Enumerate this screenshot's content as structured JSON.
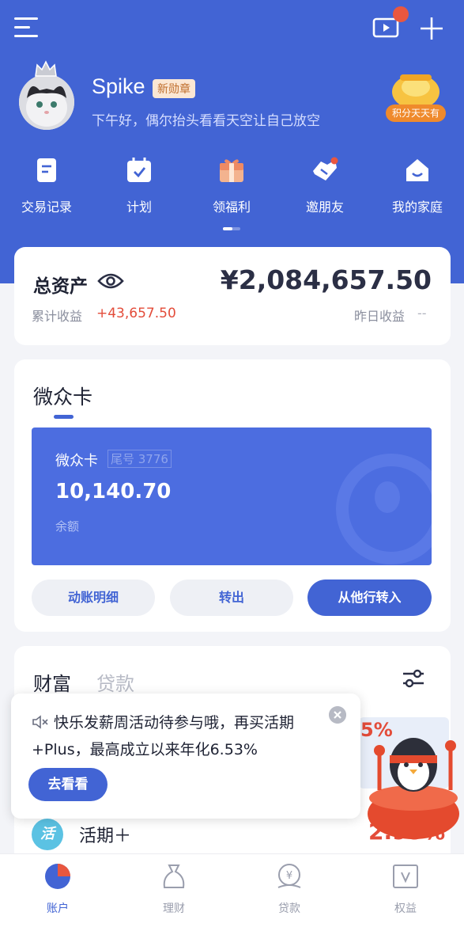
{
  "header": {
    "menu_icon": "menu-icon",
    "video_icon": "video-icon",
    "plus_icon": "plus-icon"
  },
  "profile": {
    "username": "Spike",
    "badge": "新勋章",
    "greeting": "下午好，偶尔抬头看看天空让自己放空",
    "promo_label": "积分天天有"
  },
  "quick_actions": [
    {
      "label": "交易记录",
      "icon": "document-icon"
    },
    {
      "label": "计划",
      "icon": "calendar-icon"
    },
    {
      "label": "领福利",
      "icon": "gift-icon"
    },
    {
      "label": "邀朋友",
      "icon": "handshake-icon"
    },
    {
      "label": "我的家庭",
      "icon": "home-icon"
    }
  ],
  "assets": {
    "title": "总资产",
    "total": "¥2,084,657.50",
    "cumulative_label": "累计收益",
    "cumulative_value": "+43,657.50",
    "yesterday_label": "昨日收益",
    "yesterday_value": "--"
  },
  "bank_card": {
    "section_title": "微众卡",
    "card_name": "微众卡",
    "tail": "尾号 3776",
    "balance": "10,140.70",
    "balance_label": "余额",
    "buttons": [
      "动账明细",
      "转出",
      "从他行转入"
    ]
  },
  "wealth": {
    "tab_wealth": "财富",
    "tab_loan": "贷款",
    "promo_pct": "5%",
    "item_label": "活期＋",
    "item_icon_text": "活",
    "item_rate": "2.95%"
  },
  "popup": {
    "text": "快乐发薪周活动待参与哦，再买活期+Plus，最高成立以来年化6.53%",
    "button": "去看看"
  },
  "tabbar": [
    {
      "label": "账户",
      "icon": "pie-chart-icon",
      "active": true
    },
    {
      "label": "理财",
      "icon": "money-bag-icon",
      "active": false
    },
    {
      "label": "贷款",
      "icon": "coin-icon",
      "active": false
    },
    {
      "label": "权益",
      "icon": "vip-card-icon",
      "active": false
    }
  ],
  "colors": {
    "brand": "#4264d4",
    "accent_red": "#e34c3a",
    "background": "#f3f4f8"
  }
}
